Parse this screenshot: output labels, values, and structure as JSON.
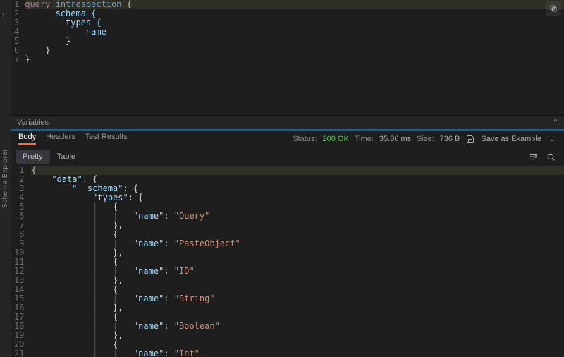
{
  "rail": {
    "label": "Schema Explorer"
  },
  "request": {
    "lines": [
      {
        "n": 1,
        "tokens": [
          {
            "t": "query",
            "c": "kw"
          },
          {
            "t": " ",
            "c": "plain"
          },
          {
            "t": "introspection",
            "c": "op"
          },
          {
            "t": " {",
            "c": "brace"
          }
        ],
        "hl": true
      },
      {
        "n": 2,
        "tokens": [
          {
            "t": "    __schema {",
            "c": "field"
          }
        ]
      },
      {
        "n": 3,
        "tokens": [
          {
            "t": "        types {",
            "c": "field"
          }
        ]
      },
      {
        "n": 4,
        "tokens": [
          {
            "t": "            name",
            "c": "field"
          }
        ]
      },
      {
        "n": 5,
        "tokens": [
          {
            "t": "        }",
            "c": "brace"
          }
        ]
      },
      {
        "n": 6,
        "tokens": [
          {
            "t": "    }",
            "c": "brace"
          }
        ]
      },
      {
        "n": 7,
        "tokens": [
          {
            "t": "}",
            "c": "brace"
          }
        ]
      }
    ],
    "variables_label": "Variables"
  },
  "response": {
    "tabs": [
      {
        "id": "body",
        "label": "Body",
        "active": true
      },
      {
        "id": "headers",
        "label": "Headers",
        "active": false
      },
      {
        "id": "tests",
        "label": "Test Results",
        "active": false
      }
    ],
    "status": {
      "status_label": "Status:",
      "status_value": "200 OK",
      "time_label": "Time:",
      "time_value": "35.86 ms",
      "size_label": "Size:",
      "size_value": "736 B",
      "save_label": "Save as Example"
    },
    "view_tabs": [
      {
        "id": "pretty",
        "label": "Pretty",
        "active": true
      },
      {
        "id": "table",
        "label": "Table",
        "active": false
      }
    ],
    "json_lines": [
      {
        "n": 1,
        "indent": 0,
        "raw": [
          {
            "t": "{",
            "c": "punc"
          }
        ],
        "hl": true
      },
      {
        "n": 2,
        "indent": 1,
        "raw": [
          {
            "t": "\"data\"",
            "c": "key"
          },
          {
            "t": ": {",
            "c": "punc"
          }
        ]
      },
      {
        "n": 3,
        "indent": 2,
        "raw": [
          {
            "t": "\"__schema\"",
            "c": "key"
          },
          {
            "t": ": {",
            "c": "punc"
          }
        ]
      },
      {
        "n": 4,
        "indent": 3,
        "raw": [
          {
            "t": "\"types\"",
            "c": "key"
          },
          {
            "t": ": [",
            "c": "punc"
          }
        ]
      },
      {
        "n": 5,
        "indent": 4,
        "raw": [
          {
            "t": "{",
            "c": "punc"
          }
        ]
      },
      {
        "n": 6,
        "indent": 5,
        "raw": [
          {
            "t": "\"name\"",
            "c": "key"
          },
          {
            "t": ": ",
            "c": "punc"
          },
          {
            "t": "\"Query\"",
            "c": "str"
          }
        ]
      },
      {
        "n": 7,
        "indent": 4,
        "raw": [
          {
            "t": "},",
            "c": "punc"
          }
        ]
      },
      {
        "n": 8,
        "indent": 4,
        "raw": [
          {
            "t": "{",
            "c": "punc"
          }
        ]
      },
      {
        "n": 9,
        "indent": 5,
        "raw": [
          {
            "t": "\"name\"",
            "c": "key"
          },
          {
            "t": ": ",
            "c": "punc"
          },
          {
            "t": "\"PasteObject\"",
            "c": "str"
          }
        ]
      },
      {
        "n": 10,
        "indent": 4,
        "raw": [
          {
            "t": "},",
            "c": "punc"
          }
        ]
      },
      {
        "n": 11,
        "indent": 4,
        "raw": [
          {
            "t": "{",
            "c": "punc"
          }
        ]
      },
      {
        "n": 12,
        "indent": 5,
        "raw": [
          {
            "t": "\"name\"",
            "c": "key"
          },
          {
            "t": ": ",
            "c": "punc"
          },
          {
            "t": "\"ID\"",
            "c": "str"
          }
        ]
      },
      {
        "n": 13,
        "indent": 4,
        "raw": [
          {
            "t": "},",
            "c": "punc"
          }
        ]
      },
      {
        "n": 14,
        "indent": 4,
        "raw": [
          {
            "t": "{",
            "c": "punc"
          }
        ]
      },
      {
        "n": 15,
        "indent": 5,
        "raw": [
          {
            "t": "\"name\"",
            "c": "key"
          },
          {
            "t": ": ",
            "c": "punc"
          },
          {
            "t": "\"String\"",
            "c": "str"
          }
        ]
      },
      {
        "n": 16,
        "indent": 4,
        "raw": [
          {
            "t": "},",
            "c": "punc"
          }
        ]
      },
      {
        "n": 17,
        "indent": 4,
        "raw": [
          {
            "t": "{",
            "c": "punc"
          }
        ]
      },
      {
        "n": 18,
        "indent": 5,
        "raw": [
          {
            "t": "\"name\"",
            "c": "key"
          },
          {
            "t": ": ",
            "c": "punc"
          },
          {
            "t": "\"Boolean\"",
            "c": "str"
          }
        ]
      },
      {
        "n": 19,
        "indent": 4,
        "raw": [
          {
            "t": "},",
            "c": "punc"
          }
        ]
      },
      {
        "n": 20,
        "indent": 4,
        "raw": [
          {
            "t": "{",
            "c": "punc"
          }
        ]
      },
      {
        "n": 21,
        "indent": 5,
        "raw": [
          {
            "t": "\"name\"",
            "c": "key"
          },
          {
            "t": ": ",
            "c": "punc"
          },
          {
            "t": "\"Int\"",
            "c": "str"
          }
        ]
      }
    ]
  }
}
